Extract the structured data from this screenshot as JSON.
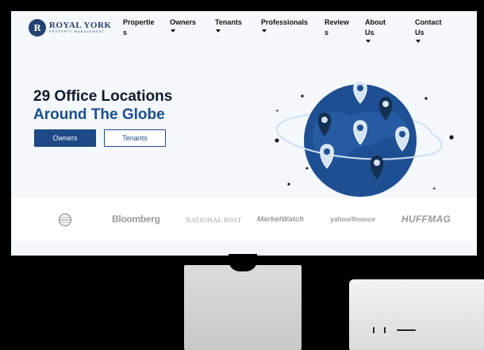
{
  "brand": {
    "name": "ROYAL YORK",
    "tagline": "PROPERTY MANAGEMENT",
    "mark": "R"
  },
  "nav": {
    "items": [
      {
        "label": "Propertie",
        "label_wrap": "s",
        "has_dropdown": false
      },
      {
        "label": "Owners",
        "has_dropdown": true
      },
      {
        "label": "Tenants",
        "has_dropdown": true
      },
      {
        "label": "Professionals",
        "has_dropdown": true
      },
      {
        "label": "Review",
        "label_wrap": "s",
        "has_dropdown": false
      },
      {
        "label": "About Us",
        "has_dropdown": true
      },
      {
        "label": "Contact Us",
        "has_dropdown": true
      }
    ]
  },
  "hero": {
    "title_line1": "29 Office Locations",
    "title_line2": "Around The Globe",
    "owners_button": "Owners",
    "tenants_button": "Tenants"
  },
  "press": {
    "logos": [
      "Bloomberg",
      "NATIONAL POST",
      "MarketWatch",
      "yahoo/finance",
      "HUFFMAG"
    ]
  },
  "colors": {
    "brand_blue": "#1d4a86",
    "globe_blue": "#1f4f93",
    "pin_light": "#d6e3f2",
    "pin_dark": "#123052"
  }
}
